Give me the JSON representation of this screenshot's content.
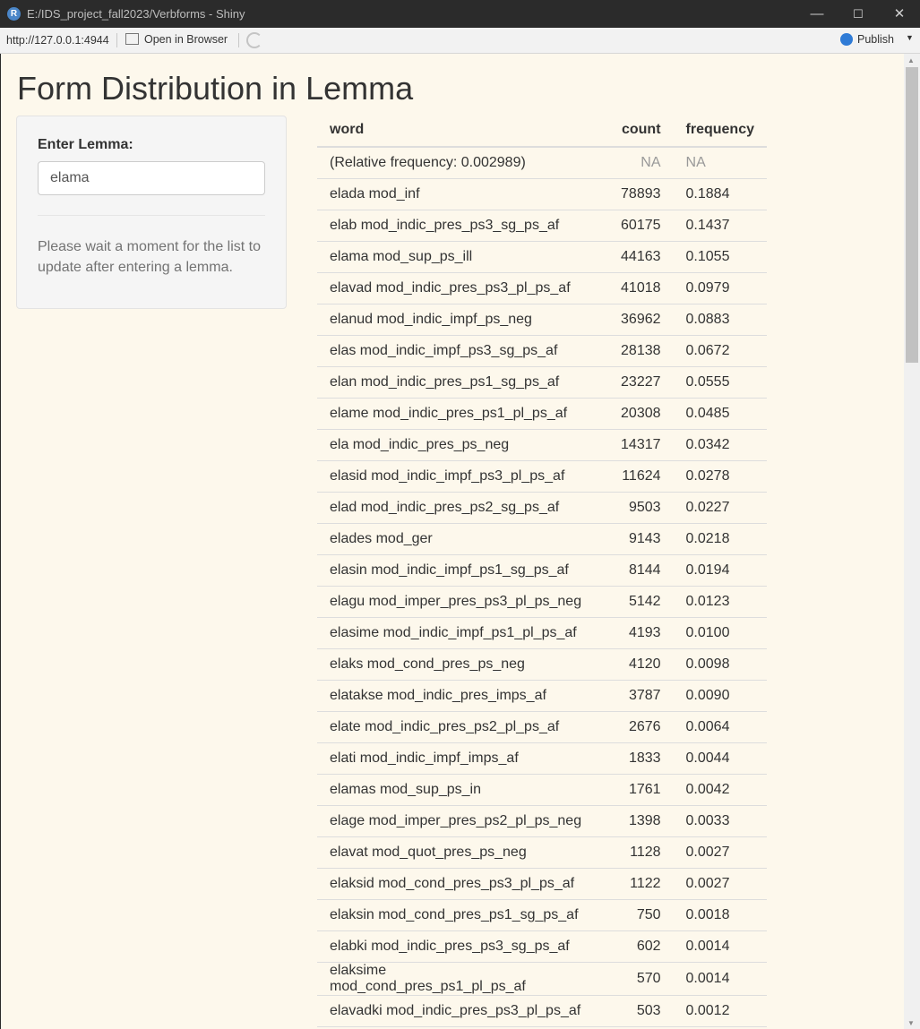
{
  "window": {
    "title": "E:/IDS_project_fall2023/Verbforms - Shiny",
    "minimize": "—",
    "maximize": "☐",
    "close": "✕"
  },
  "toolbar": {
    "url": "http://127.0.0.1:4944",
    "open_in_browser": "Open in Browser",
    "publish": "Publish"
  },
  "page": {
    "title": "Form Distribution in Lemma"
  },
  "sidebar": {
    "input_label": "Enter Lemma:",
    "input_value": "elama",
    "help_text": "Please wait a moment for the list to update after entering a lemma."
  },
  "table": {
    "headers": {
      "word": "word",
      "count": "count",
      "frequency": "frequency"
    },
    "rows": [
      {
        "word": "(Relative frequency: 0.002989)",
        "count": "NA",
        "frequency": "NA"
      },
      {
        "word": "elada mod_inf",
        "count": "78893",
        "frequency": "0.1884"
      },
      {
        "word": "elab mod_indic_pres_ps3_sg_ps_af",
        "count": "60175",
        "frequency": "0.1437"
      },
      {
        "word": "elama mod_sup_ps_ill",
        "count": "44163",
        "frequency": "0.1055"
      },
      {
        "word": "elavad mod_indic_pres_ps3_pl_ps_af",
        "count": "41018",
        "frequency": "0.0979"
      },
      {
        "word": "elanud mod_indic_impf_ps_neg",
        "count": "36962",
        "frequency": "0.0883"
      },
      {
        "word": "elas mod_indic_impf_ps3_sg_ps_af",
        "count": "28138",
        "frequency": "0.0672"
      },
      {
        "word": "elan mod_indic_pres_ps1_sg_ps_af",
        "count": "23227",
        "frequency": "0.0555"
      },
      {
        "word": "elame mod_indic_pres_ps1_pl_ps_af",
        "count": "20308",
        "frequency": "0.0485"
      },
      {
        "word": "ela mod_indic_pres_ps_neg",
        "count": "14317",
        "frequency": "0.0342"
      },
      {
        "word": "elasid mod_indic_impf_ps3_pl_ps_af",
        "count": "11624",
        "frequency": "0.0278"
      },
      {
        "word": "elad mod_indic_pres_ps2_sg_ps_af",
        "count": "9503",
        "frequency": "0.0227"
      },
      {
        "word": "elades mod_ger",
        "count": "9143",
        "frequency": "0.0218"
      },
      {
        "word": "elasin mod_indic_impf_ps1_sg_ps_af",
        "count": "8144",
        "frequency": "0.0194"
      },
      {
        "word": "elagu mod_imper_pres_ps3_pl_ps_neg",
        "count": "5142",
        "frequency": "0.0123"
      },
      {
        "word": "elasime mod_indic_impf_ps1_pl_ps_af",
        "count": "4193",
        "frequency": "0.0100"
      },
      {
        "word": "elaks mod_cond_pres_ps_neg",
        "count": "4120",
        "frequency": "0.0098"
      },
      {
        "word": "elatakse mod_indic_pres_imps_af",
        "count": "3787",
        "frequency": "0.0090"
      },
      {
        "word": "elate mod_indic_pres_ps2_pl_ps_af",
        "count": "2676",
        "frequency": "0.0064"
      },
      {
        "word": "elati mod_indic_impf_imps_af",
        "count": "1833",
        "frequency": "0.0044"
      },
      {
        "word": "elamas mod_sup_ps_in",
        "count": "1761",
        "frequency": "0.0042"
      },
      {
        "word": "elage mod_imper_pres_ps2_pl_ps_neg",
        "count": "1398",
        "frequency": "0.0033"
      },
      {
        "word": "elavat mod_quot_pres_ps_neg",
        "count": "1128",
        "frequency": "0.0027"
      },
      {
        "word": "elaksid mod_cond_pres_ps3_pl_ps_af",
        "count": "1122",
        "frequency": "0.0027"
      },
      {
        "word": "elaksin mod_cond_pres_ps1_sg_ps_af",
        "count": "750",
        "frequency": "0.0018"
      },
      {
        "word": "elabki mod_indic_pres_ps3_sg_ps_af",
        "count": "602",
        "frequency": "0.0014"
      },
      {
        "word": "elaksime mod_cond_pres_ps1_pl_ps_af",
        "count": "570",
        "frequency": "0.0014"
      },
      {
        "word": "elavadki mod_indic_pres_ps3_pl_ps_af",
        "count": "503",
        "frequency": "0.0012"
      },
      {
        "word": "",
        "count": "",
        "frequency": ""
      }
    ]
  }
}
